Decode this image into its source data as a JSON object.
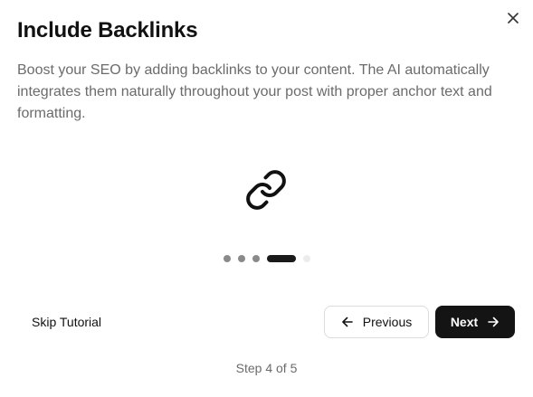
{
  "dialog": {
    "title": "Include Backlinks",
    "description": "Boost your SEO by adding backlinks to your content. The AI automatically integrates them naturally throughout your post with proper anchor text and formatting.",
    "hero_icon": "link-icon",
    "close_icon": "close-icon"
  },
  "progress": {
    "current_step": 4,
    "total_steps": 5,
    "dots": [
      {
        "state": "completed"
      },
      {
        "state": "completed"
      },
      {
        "state": "completed"
      },
      {
        "state": "active"
      },
      {
        "state": "upcoming"
      }
    ]
  },
  "footer": {
    "skip_label": "Skip Tutorial",
    "previous_label": "Previous",
    "previous_icon": "arrow-left-icon",
    "next_label": "Next",
    "next_icon": "arrow-right-icon",
    "step_text": "Step 4 of 5"
  },
  "colors": {
    "primary_button_bg": "#141414",
    "text_primary": "#111111",
    "text_secondary": "#6b6b6b",
    "dot_active": "#1a1a1a",
    "dot_completed": "#8a8a8a",
    "dot_upcoming": "#ececec"
  }
}
